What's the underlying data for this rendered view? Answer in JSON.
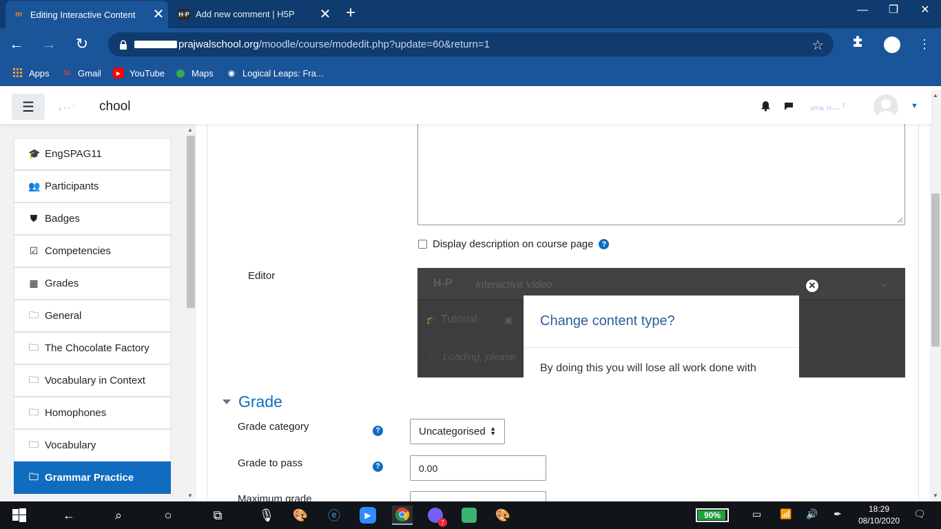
{
  "browser": {
    "tabs": [
      {
        "title": "Editing Interactive Content",
        "favicon": "moodle-icon"
      },
      {
        "title": "Add new comment | H5P",
        "favicon": "h5p-icon"
      }
    ],
    "url_host": "prajwalschool.org",
    "url_path": "/moodle/course/modedit.php?update=60&return=1",
    "bookmarks": [
      "Apps",
      "Gmail",
      "YouTube",
      "Maps",
      "Logical Leaps: Fra..."
    ]
  },
  "header": {
    "site_name": "chool"
  },
  "drawer": {
    "items": [
      {
        "label": "EngSPAG11",
        "icon": "graduation-cap-icon"
      },
      {
        "label": "Participants",
        "icon": "users-icon"
      },
      {
        "label": "Badges",
        "icon": "shield-icon"
      },
      {
        "label": "Competencies",
        "icon": "check-square-icon"
      },
      {
        "label": "Grades",
        "icon": "table-icon"
      },
      {
        "label": "General",
        "icon": "folder-icon"
      },
      {
        "label": "The Chocolate Factory",
        "icon": "folder-icon"
      },
      {
        "label": "Vocabulary in Context",
        "icon": "folder-icon"
      },
      {
        "label": "Homophones",
        "icon": "folder-icon"
      },
      {
        "label": "Vocabulary",
        "icon": "folder-icon"
      },
      {
        "label": "Grammar Practice",
        "icon": "folder-icon",
        "active": true
      }
    ]
  },
  "form": {
    "display_description_label": "Display description on course page",
    "editor_label": "Editor",
    "h5p": {
      "logo": "H-P",
      "content_type": "Interactive Video",
      "tutorial": "Tutorial",
      "loading": "Loading, please"
    },
    "dialog": {
      "title": "Change content type?",
      "body": "By doing this you will lose all work done with"
    },
    "grade_section": "Grade",
    "grade_category_label": "Grade category",
    "grade_category_value": "Uncategorised",
    "grade_to_pass_label": "Grade to pass",
    "grade_to_pass_value": "0.00",
    "maximum_grade_label": "Maximum grade"
  },
  "taskbar": {
    "battery": "90%",
    "battery_level": 0.9,
    "time": "18:29",
    "date": "08/10/2020",
    "notification_badge": "7"
  },
  "colors": {
    "chrome_dark": "#0f3b6e",
    "chrome_light": "#1a5499",
    "moodle_blue": "#0f6cbf",
    "h5p_dark": "#3d3d3d"
  }
}
